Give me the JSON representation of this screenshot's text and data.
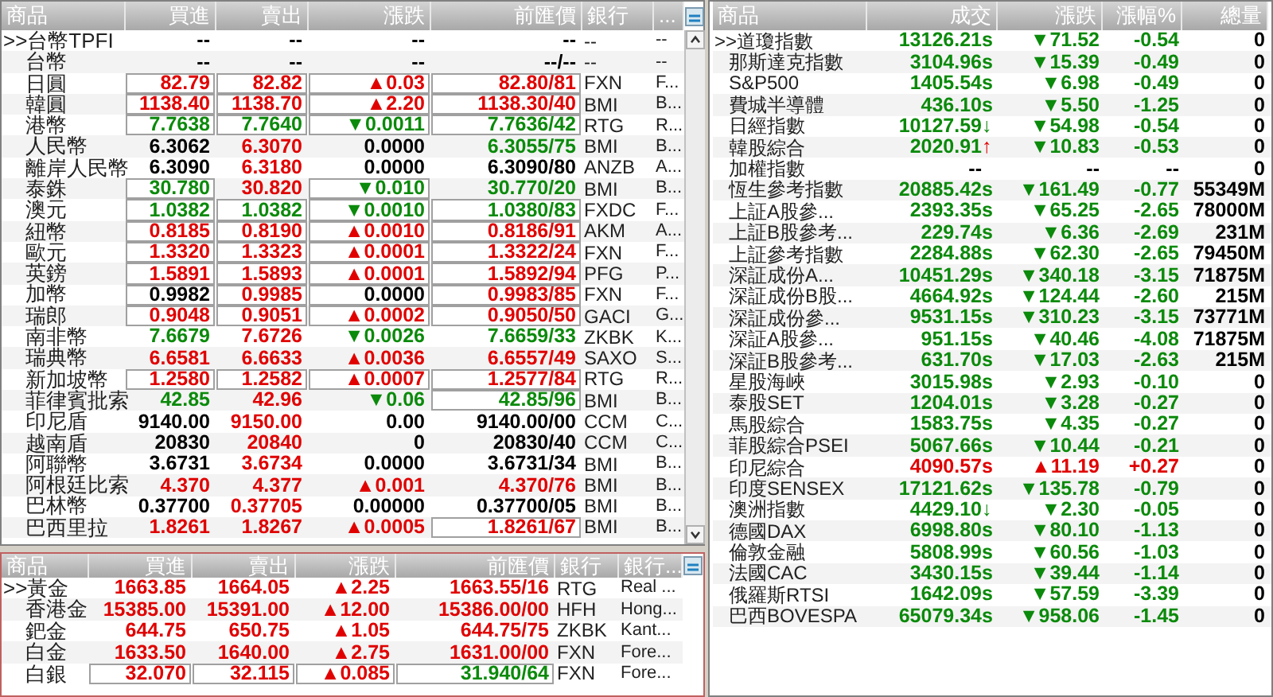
{
  "fx_table": {
    "columns": [
      "商品",
      "買進",
      "賣出",
      "漲跌",
      "前匯價",
      "銀行",
      "..."
    ],
    "rows": [
      {
        "name": ">>台幣TPFI",
        "buy": {
          "text": "--",
          "color": "#000000",
          "boxed": false
        },
        "sell": {
          "text": "--",
          "color": "#000000",
          "boxed": false
        },
        "change": {
          "text": "--",
          "color": "#000000",
          "boxed": false
        },
        "prev": {
          "text": "--",
          "color": "#000000",
          "boxed": false
        },
        "bank": "--",
        "bank_name": "--"
      },
      {
        "name": "台幣",
        "buy": {
          "text": "--",
          "color": "#000000",
          "boxed": false
        },
        "sell": {
          "text": "--",
          "color": "#000000",
          "boxed": false
        },
        "change": {
          "text": "--",
          "color": "#000000",
          "boxed": false
        },
        "prev": {
          "text": "--/--",
          "color": "#000000",
          "boxed": false
        },
        "bank": "--",
        "bank_name": "--"
      },
      {
        "name": "日圓",
        "buy": {
          "text": "82.79",
          "color": "#e00000",
          "boxed": true
        },
        "sell": {
          "text": "82.82",
          "color": "#e00000",
          "boxed": true
        },
        "change": {
          "text": "▲0.03",
          "color": "#e00000",
          "boxed": true
        },
        "prev": {
          "text": "82.80/81",
          "color": "#e00000",
          "boxed": true
        },
        "bank": "FXN",
        "bank_name": "F..."
      },
      {
        "name": "韓圓",
        "buy": {
          "text": "1138.40",
          "color": "#e00000",
          "boxed": true
        },
        "sell": {
          "text": "1138.70",
          "color": "#e00000",
          "boxed": true
        },
        "change": {
          "text": "▲2.20",
          "color": "#e00000",
          "boxed": true
        },
        "prev": {
          "text": "1138.30/40",
          "color": "#e00000",
          "boxed": true
        },
        "bank": "BMI",
        "bank_name": "B..."
      },
      {
        "name": "港幣",
        "buy": {
          "text": "7.7638",
          "color": "#0b8a0b",
          "boxed": true
        },
        "sell": {
          "text": "7.7640",
          "color": "#0b8a0b",
          "boxed": true
        },
        "change": {
          "text": "▼0.0011",
          "color": "#0b8a0b",
          "boxed": true
        },
        "prev": {
          "text": "7.7636/42",
          "color": "#0b8a0b",
          "boxed": true
        },
        "bank": "RTG",
        "bank_name": "R..."
      },
      {
        "name": "人民幣",
        "buy": {
          "text": "6.3062",
          "color": "#000000",
          "boxed": false
        },
        "sell": {
          "text": "6.3070",
          "color": "#e00000",
          "boxed": false
        },
        "change": {
          "text": "0.0000",
          "color": "#000000",
          "boxed": false
        },
        "prev": {
          "text": "6.3055/75",
          "color": "#0b8a0b",
          "boxed": false
        },
        "bank": "BMI",
        "bank_name": "B..."
      },
      {
        "name": "離岸人民幣",
        "buy": {
          "text": "6.3090",
          "color": "#000000",
          "boxed": false
        },
        "sell": {
          "text": "6.3180",
          "color": "#e00000",
          "boxed": false
        },
        "change": {
          "text": "0.0000",
          "color": "#000000",
          "boxed": false
        },
        "prev": {
          "text": "6.3090/80",
          "color": "#000000",
          "boxed": false
        },
        "bank": "ANZB",
        "bank_name": "A..."
      },
      {
        "name": "泰銖",
        "buy": {
          "text": "30.780",
          "color": "#0b8a0b",
          "boxed": true
        },
        "sell": {
          "text": "30.820",
          "color": "#e00000",
          "boxed": false
        },
        "change": {
          "text": "▼0.010",
          "color": "#0b8a0b",
          "boxed": true
        },
        "prev": {
          "text": "30.770/20",
          "color": "#0b8a0b",
          "boxed": false
        },
        "bank": "BMI",
        "bank_name": "B..."
      },
      {
        "name": "澳元",
        "buy": {
          "text": "1.0382",
          "color": "#0b8a0b",
          "boxed": true
        },
        "sell": {
          "text": "1.0382",
          "color": "#0b8a0b",
          "boxed": true
        },
        "change": {
          "text": "▼0.0010",
          "color": "#0b8a0b",
          "boxed": true
        },
        "prev": {
          "text": "1.0380/83",
          "color": "#0b8a0b",
          "boxed": true
        },
        "bank": "FXDC",
        "bank_name": "F..."
      },
      {
        "name": "紐幣",
        "buy": {
          "text": "0.8185",
          "color": "#e00000",
          "boxed": true
        },
        "sell": {
          "text": "0.8190",
          "color": "#e00000",
          "boxed": true
        },
        "change": {
          "text": "▲0.0010",
          "color": "#e00000",
          "boxed": true
        },
        "prev": {
          "text": "0.8186/91",
          "color": "#e00000",
          "boxed": true
        },
        "bank": "AKM",
        "bank_name": "A..."
      },
      {
        "name": "歐元",
        "buy": {
          "text": "1.3320",
          "color": "#e00000",
          "boxed": true
        },
        "sell": {
          "text": "1.3323",
          "color": "#e00000",
          "boxed": true
        },
        "change": {
          "text": "▲0.0001",
          "color": "#e00000",
          "boxed": true
        },
        "prev": {
          "text": "1.3322/24",
          "color": "#e00000",
          "boxed": true
        },
        "bank": "FXN",
        "bank_name": "F..."
      },
      {
        "name": "英鎊",
        "buy": {
          "text": "1.5891",
          "color": "#e00000",
          "boxed": true
        },
        "sell": {
          "text": "1.5893",
          "color": "#e00000",
          "boxed": true
        },
        "change": {
          "text": "▲0.0001",
          "color": "#e00000",
          "boxed": true
        },
        "prev": {
          "text": "1.5892/94",
          "color": "#e00000",
          "boxed": true
        },
        "bank": "PFG",
        "bank_name": "P..."
      },
      {
        "name": "加幣",
        "buy": {
          "text": "0.9982",
          "color": "#000000",
          "boxed": true
        },
        "sell": {
          "text": "0.9985",
          "color": "#e00000",
          "boxed": true
        },
        "change": {
          "text": "0.0000",
          "color": "#000000",
          "boxed": true
        },
        "prev": {
          "text": "0.9983/85",
          "color": "#e00000",
          "boxed": true
        },
        "bank": "FXN",
        "bank_name": "F..."
      },
      {
        "name": "瑞郎",
        "buy": {
          "text": "0.9048",
          "color": "#e00000",
          "boxed": true
        },
        "sell": {
          "text": "0.9051",
          "color": "#e00000",
          "boxed": true
        },
        "change": {
          "text": "▲0.0002",
          "color": "#e00000",
          "boxed": true
        },
        "prev": {
          "text": "0.9050/50",
          "color": "#e00000",
          "boxed": true
        },
        "bank": "GACI",
        "bank_name": "G..."
      },
      {
        "name": "南非幣",
        "buy": {
          "text": "7.6679",
          "color": "#0b8a0b",
          "boxed": false
        },
        "sell": {
          "text": "7.6726",
          "color": "#e00000",
          "boxed": false
        },
        "change": {
          "text": "▼0.0026",
          "color": "#0b8a0b",
          "boxed": false
        },
        "prev": {
          "text": "7.6659/33",
          "color": "#0b8a0b",
          "boxed": false
        },
        "bank": "ZKBK",
        "bank_name": "K..."
      },
      {
        "name": "瑞典幣",
        "buy": {
          "text": "6.6581",
          "color": "#e00000",
          "boxed": false
        },
        "sell": {
          "text": "6.6633",
          "color": "#e00000",
          "boxed": false
        },
        "change": {
          "text": "▲0.0036",
          "color": "#e00000",
          "boxed": false
        },
        "prev": {
          "text": "6.6557/49",
          "color": "#e00000",
          "boxed": false
        },
        "bank": "SAXO",
        "bank_name": "S..."
      },
      {
        "name": "新加坡幣",
        "buy": {
          "text": "1.2580",
          "color": "#e00000",
          "boxed": true
        },
        "sell": {
          "text": "1.2582",
          "color": "#e00000",
          "boxed": true
        },
        "change": {
          "text": "▲0.0007",
          "color": "#e00000",
          "boxed": true
        },
        "prev": {
          "text": "1.2577/84",
          "color": "#e00000",
          "boxed": true
        },
        "bank": "RTG",
        "bank_name": "R..."
      },
      {
        "name": "菲律賓批索",
        "buy": {
          "text": "42.85",
          "color": "#0b8a0b",
          "boxed": false
        },
        "sell": {
          "text": "42.96",
          "color": "#e00000",
          "boxed": false
        },
        "change": {
          "text": "▼0.06",
          "color": "#0b8a0b",
          "boxed": false
        },
        "prev": {
          "text": "42.85/96",
          "color": "#0b8a0b",
          "boxed": true
        },
        "bank": "BMI",
        "bank_name": "B..."
      },
      {
        "name": "印尼盾",
        "buy": {
          "text": "9140.00",
          "color": "#000000",
          "boxed": false
        },
        "sell": {
          "text": "9150.00",
          "color": "#e00000",
          "boxed": false
        },
        "change": {
          "text": "0.00",
          "color": "#000000",
          "boxed": false
        },
        "prev": {
          "text": "9140.00/00",
          "color": "#000000",
          "boxed": false
        },
        "bank": "CCM",
        "bank_name": "C..."
      },
      {
        "name": "越南盾",
        "buy": {
          "text": "20830",
          "color": "#000000",
          "boxed": false
        },
        "sell": {
          "text": "20840",
          "color": "#e00000",
          "boxed": false
        },
        "change": {
          "text": "0",
          "color": "#000000",
          "boxed": false
        },
        "prev": {
          "text": "20830/40",
          "color": "#000000",
          "boxed": false
        },
        "bank": "CCM",
        "bank_name": "C..."
      },
      {
        "name": "阿聯幣",
        "buy": {
          "text": "3.6731",
          "color": "#000000",
          "boxed": false
        },
        "sell": {
          "text": "3.6734",
          "color": "#e00000",
          "boxed": false
        },
        "change": {
          "text": "0.0000",
          "color": "#000000",
          "boxed": false
        },
        "prev": {
          "text": "3.6731/34",
          "color": "#000000",
          "boxed": false
        },
        "bank": "BMI",
        "bank_name": "B..."
      },
      {
        "name": "阿根廷比索",
        "buy": {
          "text": "4.370",
          "color": "#e00000",
          "boxed": false
        },
        "sell": {
          "text": "4.377",
          "color": "#e00000",
          "boxed": false
        },
        "change": {
          "text": "▲0.001",
          "color": "#e00000",
          "boxed": false
        },
        "prev": {
          "text": "4.370/76",
          "color": "#e00000",
          "boxed": false
        },
        "bank": "BMI",
        "bank_name": "B..."
      },
      {
        "name": "巴林幣",
        "buy": {
          "text": "0.37700",
          "color": "#000000",
          "boxed": false
        },
        "sell": {
          "text": "0.37705",
          "color": "#e00000",
          "boxed": false
        },
        "change": {
          "text": "0.00000",
          "color": "#000000",
          "boxed": false
        },
        "prev": {
          "text": "0.37700/05",
          "color": "#000000",
          "boxed": false
        },
        "bank": "BMI",
        "bank_name": "B..."
      },
      {
        "name": "巴西里拉",
        "buy": {
          "text": "1.8261",
          "color": "#e00000",
          "boxed": false
        },
        "sell": {
          "text": "1.8267",
          "color": "#e00000",
          "boxed": false
        },
        "change": {
          "text": "▲0.0005",
          "color": "#e00000",
          "boxed": false
        },
        "prev": {
          "text": "1.8261/67",
          "color": "#e00000",
          "boxed": true
        },
        "bank": "BMI",
        "bank_name": "B..."
      }
    ]
  },
  "metals_table": {
    "columns": [
      "商品",
      "買進",
      "賣出",
      "漲跌",
      "前匯價",
      "銀行",
      "銀行..."
    ],
    "rows": [
      {
        "name": ">>黃金",
        "buy": {
          "text": "1663.85",
          "color": "#e00000",
          "boxed": false
        },
        "sell": {
          "text": "1664.05",
          "color": "#e00000",
          "boxed": false
        },
        "change": {
          "text": "▲2.25",
          "color": "#e00000",
          "boxed": false
        },
        "prev": {
          "text": "1663.55/16",
          "color": "#e00000",
          "boxed": false
        },
        "bank": "RTG",
        "bank_name": "Real ..."
      },
      {
        "name": "香港金",
        "buy": {
          "text": "15385.00",
          "color": "#e00000",
          "boxed": false
        },
        "sell": {
          "text": "15391.00",
          "color": "#e00000",
          "boxed": false
        },
        "change": {
          "text": "▲12.00",
          "color": "#e00000",
          "boxed": false
        },
        "prev": {
          "text": "15386.00/00",
          "color": "#e00000",
          "boxed": false
        },
        "bank": "HFH",
        "bank_name": "Hong..."
      },
      {
        "name": "鈀金",
        "buy": {
          "text": "644.75",
          "color": "#e00000",
          "boxed": false
        },
        "sell": {
          "text": "650.75",
          "color": "#e00000",
          "boxed": false
        },
        "change": {
          "text": "▲1.05",
          "color": "#e00000",
          "boxed": false
        },
        "prev": {
          "text": "644.75/75",
          "color": "#e00000",
          "boxed": false
        },
        "bank": "ZKBK",
        "bank_name": "Kant..."
      },
      {
        "name": "白金",
        "buy": {
          "text": "1633.50",
          "color": "#e00000",
          "boxed": false
        },
        "sell": {
          "text": "1640.00",
          "color": "#e00000",
          "boxed": false
        },
        "change": {
          "text": "▲2.75",
          "color": "#e00000",
          "boxed": false
        },
        "prev": {
          "text": "1631.00/00",
          "color": "#e00000",
          "boxed": false
        },
        "bank": "FXN",
        "bank_name": "Fore..."
      },
      {
        "name": "白銀",
        "buy": {
          "text": "32.070",
          "color": "#e00000",
          "boxed": true
        },
        "sell": {
          "text": "32.115",
          "color": "#e00000",
          "boxed": true
        },
        "change": {
          "text": "▲0.085",
          "color": "#e00000",
          "boxed": true
        },
        "prev": {
          "text": "31.940/64",
          "color": "#0b8a0b",
          "boxed": true
        },
        "bank": "FXN",
        "bank_name": "Fore..."
      }
    ]
  },
  "index_table": {
    "columns": [
      "商品",
      "成交",
      "漲跌",
      "漲幅%",
      "總量"
    ],
    "rows": [
      {
        "name": ">>道瓊指數",
        "price": "13126.21",
        "mark": {
          "text": "s",
          "color": "#0b8a0b"
        },
        "change": "▼71.52",
        "pct": "-0.54",
        "color": "#0b8a0b",
        "volume": "0"
      },
      {
        "name": "那斯達克指數",
        "price": "3104.96",
        "mark": {
          "text": "s",
          "color": "#0b8a0b"
        },
        "change": "▼15.39",
        "pct": "-0.49",
        "color": "#0b8a0b",
        "volume": "0"
      },
      {
        "name": "S&P500",
        "price": "1405.54",
        "mark": {
          "text": "s",
          "color": "#0b8a0b"
        },
        "change": "▼6.98",
        "pct": "-0.49",
        "color": "#0b8a0b",
        "volume": "0"
      },
      {
        "name": "費城半導體",
        "price": "436.10",
        "mark": {
          "text": "s",
          "color": "#0b8a0b"
        },
        "change": "▼5.50",
        "pct": "-1.25",
        "color": "#0b8a0b",
        "volume": "0"
      },
      {
        "name": "日經指數",
        "price": "10127.59",
        "mark": {
          "text": "↓",
          "color": "#0b8a0b"
        },
        "change": "▼54.98",
        "pct": "-0.54",
        "color": "#0b8a0b",
        "volume": "0"
      },
      {
        "name": "韓股綜合",
        "price": "2020.91",
        "mark": {
          "text": "↑",
          "color": "#e00000"
        },
        "change": "▼10.83",
        "pct": "-0.53",
        "color": "#0b8a0b",
        "volume": "0"
      },
      {
        "name": "加權指數",
        "price": "--",
        "change": "--",
        "pct": "--",
        "color": "#000000",
        "volume": "0"
      },
      {
        "name": "恆生參考指數",
        "price": "20885.42",
        "mark": {
          "text": "s",
          "color": "#0b8a0b"
        },
        "change": "▼161.49",
        "pct": "-0.77",
        "color": "#0b8a0b",
        "volume": "55349M"
      },
      {
        "name": "上証A股參...",
        "price": "2393.35",
        "mark": {
          "text": "s",
          "color": "#0b8a0b"
        },
        "change": "▼65.25",
        "pct": "-2.65",
        "color": "#0b8a0b",
        "volume": "78000M"
      },
      {
        "name": "上証B股參考...",
        "price": "229.74",
        "mark": {
          "text": "s",
          "color": "#0b8a0b"
        },
        "change": "▼6.36",
        "pct": "-2.69",
        "color": "#0b8a0b",
        "volume": "231M"
      },
      {
        "name": "上証參考指數",
        "price": "2284.88",
        "mark": {
          "text": "s",
          "color": "#0b8a0b"
        },
        "change": "▼62.30",
        "pct": "-2.65",
        "color": "#0b8a0b",
        "volume": "79450M"
      },
      {
        "name": "深証成份A...",
        "price": "10451.29",
        "mark": {
          "text": "s",
          "color": "#0b8a0b"
        },
        "change": "▼340.18",
        "pct": "-3.15",
        "color": "#0b8a0b",
        "volume": "71875M"
      },
      {
        "name": "深証成份B股...",
        "price": "4664.92",
        "mark": {
          "text": "s",
          "color": "#0b8a0b"
        },
        "change": "▼124.44",
        "pct": "-2.60",
        "color": "#0b8a0b",
        "volume": "215M"
      },
      {
        "name": "深証成份參...",
        "price": "9531.15",
        "mark": {
          "text": "s",
          "color": "#0b8a0b"
        },
        "change": "▼310.23",
        "pct": "-3.15",
        "color": "#0b8a0b",
        "volume": "73771M"
      },
      {
        "name": "深証A股參...",
        "price": "951.15",
        "mark": {
          "text": "s",
          "color": "#0b8a0b"
        },
        "change": "▼40.46",
        "pct": "-4.08",
        "color": "#0b8a0b",
        "volume": "71875M"
      },
      {
        "name": "深証B股參考...",
        "price": "631.70",
        "mark": {
          "text": "s",
          "color": "#0b8a0b"
        },
        "change": "▼17.03",
        "pct": "-2.63",
        "color": "#0b8a0b",
        "volume": "215M"
      },
      {
        "name": "星股海峽",
        "price": "3015.98",
        "mark": {
          "text": "s",
          "color": "#0b8a0b"
        },
        "change": "▼2.93",
        "pct": "-0.10",
        "color": "#0b8a0b",
        "volume": "0"
      },
      {
        "name": "泰股SET",
        "price": "1204.01",
        "mark": {
          "text": "s",
          "color": "#0b8a0b"
        },
        "change": "▼3.28",
        "pct": "-0.27",
        "color": "#0b8a0b",
        "volume": "0"
      },
      {
        "name": "馬股綜合",
        "price": "1583.75",
        "mark": {
          "text": "s",
          "color": "#0b8a0b"
        },
        "change": "▼4.35",
        "pct": "-0.27",
        "color": "#0b8a0b",
        "volume": "0"
      },
      {
        "name": "菲股綜合PSEI",
        "price": "5067.66",
        "mark": {
          "text": "s",
          "color": "#0b8a0b"
        },
        "change": "▼10.44",
        "pct": "-0.21",
        "color": "#0b8a0b",
        "volume": "0"
      },
      {
        "name": "印尼綜合",
        "price": "4090.57",
        "mark": {
          "text": "s",
          "color": "#e00000"
        },
        "change": "▲11.19",
        "pct": "+0.27",
        "color": "#e00000",
        "volume": "0"
      },
      {
        "name": "印度SENSEX",
        "price": "17121.62",
        "mark": {
          "text": "s",
          "color": "#0b8a0b"
        },
        "change": "▼135.78",
        "pct": "-0.79",
        "color": "#0b8a0b",
        "volume": "0"
      },
      {
        "name": "澳洲指數",
        "price": "4429.10",
        "mark": {
          "text": "↓",
          "color": "#0b8a0b"
        },
        "change": "▼2.30",
        "pct": "-0.05",
        "color": "#0b8a0b",
        "volume": "0"
      },
      {
        "name": "德國DAX",
        "price": "6998.80",
        "mark": {
          "text": "s",
          "color": "#0b8a0b"
        },
        "change": "▼80.10",
        "pct": "-1.13",
        "color": "#0b8a0b",
        "volume": "0"
      },
      {
        "name": "倫敦金融",
        "price": "5808.99",
        "mark": {
          "text": "s",
          "color": "#0b8a0b"
        },
        "change": "▼60.56",
        "pct": "-1.03",
        "color": "#0b8a0b",
        "volume": "0"
      },
      {
        "name": "法國CAC",
        "price": "3430.15",
        "mark": {
          "text": "s",
          "color": "#0b8a0b"
        },
        "change": "▼39.44",
        "pct": "-1.14",
        "color": "#0b8a0b",
        "volume": "0"
      },
      {
        "name": "俄羅斯RTSI",
        "price": "1642.09",
        "mark": {
          "text": "s",
          "color": "#0b8a0b"
        },
        "change": "▼57.59",
        "pct": "-3.39",
        "color": "#0b8a0b",
        "volume": "0"
      },
      {
        "name": "巴西BOVESPA",
        "price": "65079.34",
        "mark": {
          "text": "s",
          "color": "#0b8a0b"
        },
        "change": "▼958.06",
        "pct": "-1.45",
        "color": "#0b8a0b",
        "volume": "0"
      }
    ]
  }
}
